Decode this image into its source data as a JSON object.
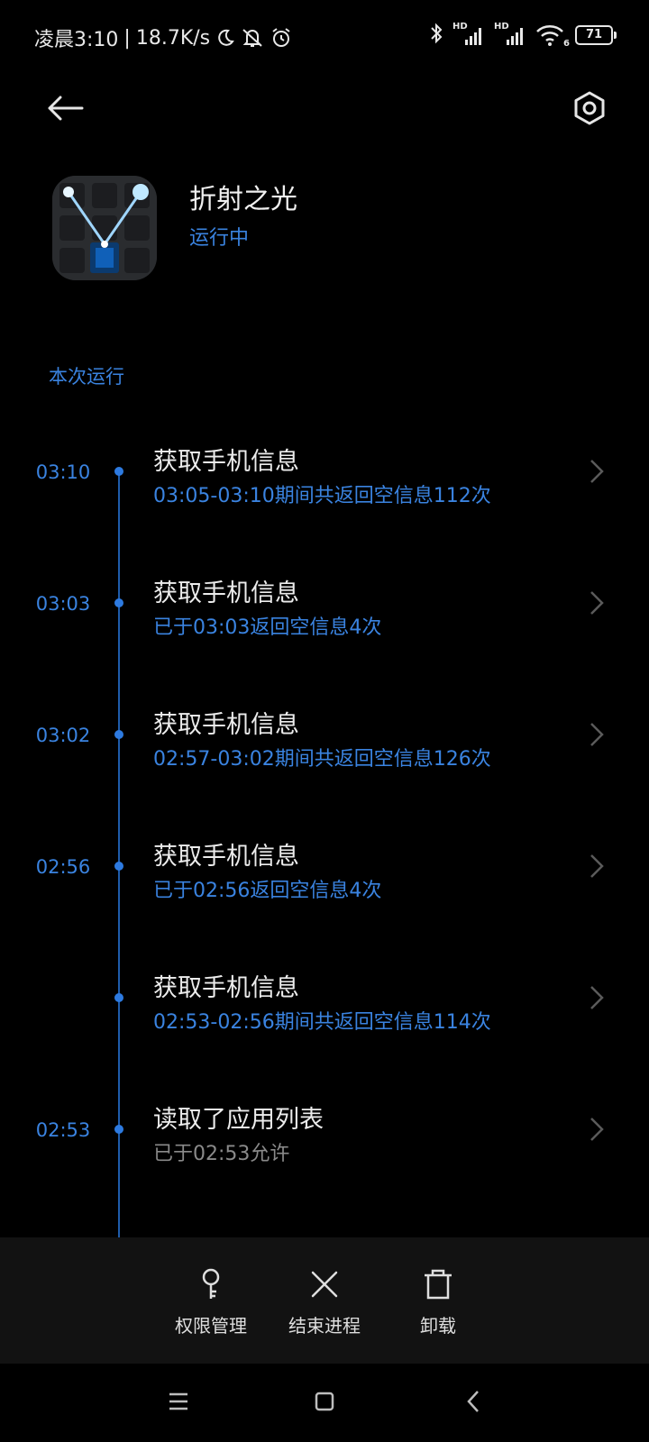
{
  "status_bar": {
    "time_text": "凌晨3:10",
    "separator": "|",
    "network_speed": "18.7K/s",
    "signal_label_1": "HD",
    "signal_label_2": "HD",
    "wifi_badge": "6",
    "battery_level": "71"
  },
  "app": {
    "name": "折射之光",
    "status": "运行中"
  },
  "section_title": "本次运行",
  "timeline": [
    {
      "time": "03:10",
      "title": "获取手机信息",
      "subtitle": "03:05-03:10期间共返回空信息112次",
      "subtitle_color": "blue"
    },
    {
      "time": "03:03",
      "title": "获取手机信息",
      "subtitle": "已于03:03返回空信息4次",
      "subtitle_color": "blue"
    },
    {
      "time": "03:02",
      "title": "获取手机信息",
      "subtitle": "02:57-03:02期间共返回空信息126次",
      "subtitle_color": "blue"
    },
    {
      "time": "02:56",
      "title": "获取手机信息",
      "subtitle": "已于02:56返回空信息4次",
      "subtitle_color": "blue"
    },
    {
      "time": "",
      "title": "获取手机信息",
      "subtitle": "02:53-02:56期间共返回空信息114次",
      "subtitle_color": "blue"
    },
    {
      "time": "02:53",
      "title": "读取了应用列表",
      "subtitle": "已于02:53允许",
      "subtitle_color": "grey"
    }
  ],
  "actions": {
    "permissions_label": "权限管理",
    "force_stop_label": "结束进程",
    "uninstall_label": "卸载"
  },
  "colors": {
    "accent": "#3a83e0",
    "background": "#000000",
    "action_bar": "#121212",
    "muted_text": "#8a8a8a"
  },
  "icons": {
    "back": "arrow-left-icon",
    "settings": "gear-icon",
    "permissions": "key-icon",
    "force_stop": "close-icon",
    "uninstall": "trash-icon",
    "chevron": "chevron-right-icon",
    "nav_menu": "menu-icon",
    "nav_home": "home-icon",
    "nav_back": "nav-back-icon"
  }
}
